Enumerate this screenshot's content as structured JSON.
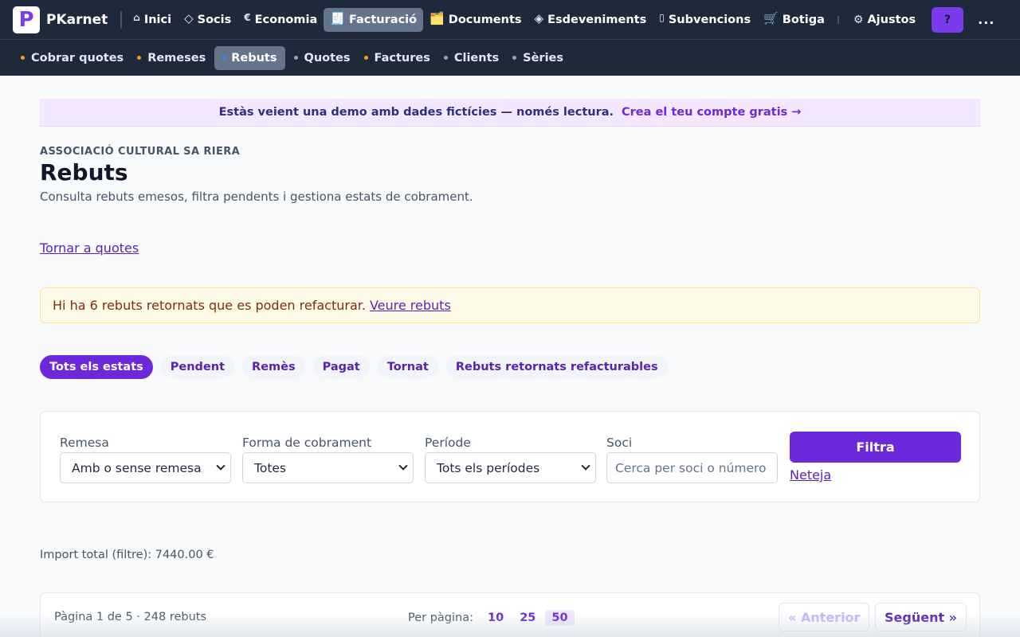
{
  "app": {
    "brand": "PKarnet",
    "logo_letter": "P"
  },
  "topnav": {
    "items": [
      {
        "icon": "⌂",
        "label": "Inici"
      },
      {
        "icon": "◇",
        "label": "Socis"
      },
      {
        "icon": "€",
        "label": "Economia"
      },
      {
        "icon": "🧾",
        "label": "Facturació"
      },
      {
        "icon": "🗂️",
        "label": "Documents"
      },
      {
        "icon": "◈",
        "label": "Esdeveniments"
      },
      {
        "icon": "▯",
        "label": "Subvencions"
      },
      {
        "icon": "🛒",
        "label": "Botiga"
      }
    ],
    "settings": {
      "icon": "⚙",
      "label": "Ajustos"
    },
    "help_label": "?",
    "more_label": "..."
  },
  "subnav": {
    "items": [
      {
        "label": "Cobrar quotes",
        "dot_color": "#f59e0b"
      },
      {
        "label": "Remeses",
        "dot_color": "#f59e0b"
      },
      {
        "label": "Rebuts",
        "dot_color": "#3b82f6"
      },
      {
        "label": "Quotes",
        "dot_color": "#94a3b8"
      },
      {
        "label": "Factures",
        "dot_color": "#f59e0b"
      },
      {
        "label": "Clients",
        "dot_color": "#94a3b8"
      },
      {
        "label": "Sèries",
        "dot_color": "#94a3b8"
      }
    ]
  },
  "banner": {
    "message": "Estàs veient una demo amb dades fictícies — només lectura.",
    "cta": "Crea el teu compte gratis →"
  },
  "page": {
    "organization": "ASSOCIACIÓ CULTURAL SA RIERA",
    "title": "Rebuts",
    "subtitle": "Consulta rebuts emesos, filtra pendents i gestiona estats de cobrament.",
    "back_link": "Tornar a quotes"
  },
  "warning": {
    "text": "Hi ha 6 rebuts retornats que es poden refacturar.",
    "link": "Veure rebuts"
  },
  "status_tabs": [
    {
      "label": "Tots els estats"
    },
    {
      "label": "Pendent"
    },
    {
      "label": "Remès"
    },
    {
      "label": "Pagat"
    },
    {
      "label": "Tornat"
    },
    {
      "label": "Rebuts retornats refacturables"
    }
  ],
  "filters": {
    "remesa": {
      "label": "Remesa",
      "value": "Amb o sense remesa"
    },
    "forma": {
      "label": "Forma de cobrament",
      "value": "Totes"
    },
    "periode": {
      "label": "Període",
      "value": "Tots els períodes"
    },
    "soci": {
      "label": "Soci",
      "placeholder": "Cerca per soci o número"
    },
    "submit_label": "Filtra",
    "clear_label": "Neteja"
  },
  "summary": {
    "total_text": "Import total (filtre): 7440.00 €"
  },
  "pagination": {
    "info": "Pàgina 1 de 5 · 248 rebuts",
    "per_page_label": "Per pàgina:",
    "per_page_options": [
      "10",
      "25",
      "50"
    ],
    "per_page_selected": "50",
    "prev_label": "« Anterior",
    "next_label": "Següent »"
  }
}
